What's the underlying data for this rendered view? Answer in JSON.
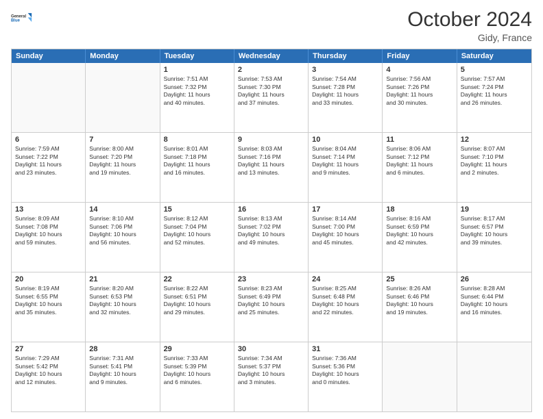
{
  "header": {
    "logo_general": "General",
    "logo_blue": "Blue",
    "month_title": "October 2024",
    "location": "Gidy, France"
  },
  "weekdays": [
    "Sunday",
    "Monday",
    "Tuesday",
    "Wednesday",
    "Thursday",
    "Friday",
    "Saturday"
  ],
  "weeks": [
    [
      {
        "day": "",
        "lines": []
      },
      {
        "day": "",
        "lines": []
      },
      {
        "day": "1",
        "lines": [
          "Sunrise: 7:51 AM",
          "Sunset: 7:32 PM",
          "Daylight: 11 hours",
          "and 40 minutes."
        ]
      },
      {
        "day": "2",
        "lines": [
          "Sunrise: 7:53 AM",
          "Sunset: 7:30 PM",
          "Daylight: 11 hours",
          "and 37 minutes."
        ]
      },
      {
        "day": "3",
        "lines": [
          "Sunrise: 7:54 AM",
          "Sunset: 7:28 PM",
          "Daylight: 11 hours",
          "and 33 minutes."
        ]
      },
      {
        "day": "4",
        "lines": [
          "Sunrise: 7:56 AM",
          "Sunset: 7:26 PM",
          "Daylight: 11 hours",
          "and 30 minutes."
        ]
      },
      {
        "day": "5",
        "lines": [
          "Sunrise: 7:57 AM",
          "Sunset: 7:24 PM",
          "Daylight: 11 hours",
          "and 26 minutes."
        ]
      }
    ],
    [
      {
        "day": "6",
        "lines": [
          "Sunrise: 7:59 AM",
          "Sunset: 7:22 PM",
          "Daylight: 11 hours",
          "and 23 minutes."
        ]
      },
      {
        "day": "7",
        "lines": [
          "Sunrise: 8:00 AM",
          "Sunset: 7:20 PM",
          "Daylight: 11 hours",
          "and 19 minutes."
        ]
      },
      {
        "day": "8",
        "lines": [
          "Sunrise: 8:01 AM",
          "Sunset: 7:18 PM",
          "Daylight: 11 hours",
          "and 16 minutes."
        ]
      },
      {
        "day": "9",
        "lines": [
          "Sunrise: 8:03 AM",
          "Sunset: 7:16 PM",
          "Daylight: 11 hours",
          "and 13 minutes."
        ]
      },
      {
        "day": "10",
        "lines": [
          "Sunrise: 8:04 AM",
          "Sunset: 7:14 PM",
          "Daylight: 11 hours",
          "and 9 minutes."
        ]
      },
      {
        "day": "11",
        "lines": [
          "Sunrise: 8:06 AM",
          "Sunset: 7:12 PM",
          "Daylight: 11 hours",
          "and 6 minutes."
        ]
      },
      {
        "day": "12",
        "lines": [
          "Sunrise: 8:07 AM",
          "Sunset: 7:10 PM",
          "Daylight: 11 hours",
          "and 2 minutes."
        ]
      }
    ],
    [
      {
        "day": "13",
        "lines": [
          "Sunrise: 8:09 AM",
          "Sunset: 7:08 PM",
          "Daylight: 10 hours",
          "and 59 minutes."
        ]
      },
      {
        "day": "14",
        "lines": [
          "Sunrise: 8:10 AM",
          "Sunset: 7:06 PM",
          "Daylight: 10 hours",
          "and 56 minutes."
        ]
      },
      {
        "day": "15",
        "lines": [
          "Sunrise: 8:12 AM",
          "Sunset: 7:04 PM",
          "Daylight: 10 hours",
          "and 52 minutes."
        ]
      },
      {
        "day": "16",
        "lines": [
          "Sunrise: 8:13 AM",
          "Sunset: 7:02 PM",
          "Daylight: 10 hours",
          "and 49 minutes."
        ]
      },
      {
        "day": "17",
        "lines": [
          "Sunrise: 8:14 AM",
          "Sunset: 7:00 PM",
          "Daylight: 10 hours",
          "and 45 minutes."
        ]
      },
      {
        "day": "18",
        "lines": [
          "Sunrise: 8:16 AM",
          "Sunset: 6:59 PM",
          "Daylight: 10 hours",
          "and 42 minutes."
        ]
      },
      {
        "day": "19",
        "lines": [
          "Sunrise: 8:17 AM",
          "Sunset: 6:57 PM",
          "Daylight: 10 hours",
          "and 39 minutes."
        ]
      }
    ],
    [
      {
        "day": "20",
        "lines": [
          "Sunrise: 8:19 AM",
          "Sunset: 6:55 PM",
          "Daylight: 10 hours",
          "and 35 minutes."
        ]
      },
      {
        "day": "21",
        "lines": [
          "Sunrise: 8:20 AM",
          "Sunset: 6:53 PM",
          "Daylight: 10 hours",
          "and 32 minutes."
        ]
      },
      {
        "day": "22",
        "lines": [
          "Sunrise: 8:22 AM",
          "Sunset: 6:51 PM",
          "Daylight: 10 hours",
          "and 29 minutes."
        ]
      },
      {
        "day": "23",
        "lines": [
          "Sunrise: 8:23 AM",
          "Sunset: 6:49 PM",
          "Daylight: 10 hours",
          "and 25 minutes."
        ]
      },
      {
        "day": "24",
        "lines": [
          "Sunrise: 8:25 AM",
          "Sunset: 6:48 PM",
          "Daylight: 10 hours",
          "and 22 minutes."
        ]
      },
      {
        "day": "25",
        "lines": [
          "Sunrise: 8:26 AM",
          "Sunset: 6:46 PM",
          "Daylight: 10 hours",
          "and 19 minutes."
        ]
      },
      {
        "day": "26",
        "lines": [
          "Sunrise: 8:28 AM",
          "Sunset: 6:44 PM",
          "Daylight: 10 hours",
          "and 16 minutes."
        ]
      }
    ],
    [
      {
        "day": "27",
        "lines": [
          "Sunrise: 7:29 AM",
          "Sunset: 5:42 PM",
          "Daylight: 10 hours",
          "and 12 minutes."
        ]
      },
      {
        "day": "28",
        "lines": [
          "Sunrise: 7:31 AM",
          "Sunset: 5:41 PM",
          "Daylight: 10 hours",
          "and 9 minutes."
        ]
      },
      {
        "day": "29",
        "lines": [
          "Sunrise: 7:33 AM",
          "Sunset: 5:39 PM",
          "Daylight: 10 hours",
          "and 6 minutes."
        ]
      },
      {
        "day": "30",
        "lines": [
          "Sunrise: 7:34 AM",
          "Sunset: 5:37 PM",
          "Daylight: 10 hours",
          "and 3 minutes."
        ]
      },
      {
        "day": "31",
        "lines": [
          "Sunrise: 7:36 AM",
          "Sunset: 5:36 PM",
          "Daylight: 10 hours",
          "and 0 minutes."
        ]
      },
      {
        "day": "",
        "lines": []
      },
      {
        "day": "",
        "lines": []
      }
    ]
  ]
}
